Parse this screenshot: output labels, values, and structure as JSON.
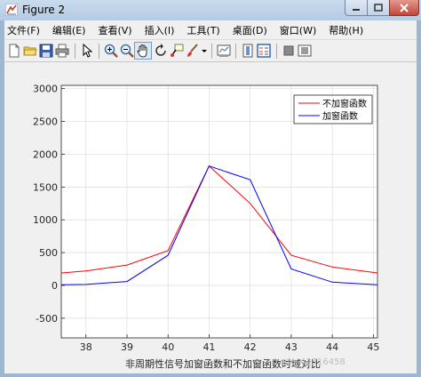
{
  "window": {
    "title": "Figure 2"
  },
  "menu": [
    "文件(F)",
    "编辑(E)",
    "查看(V)",
    "插入(I)",
    "工具(T)",
    "桌面(D)",
    "窗口(W)",
    "帮助(H)"
  ],
  "toolbar": {
    "icons": [
      "new-file-icon",
      "open-folder-icon",
      "save-icon",
      "print-icon",
      "pointer-icon",
      "zoom-in-icon",
      "zoom-out-icon",
      "pan-hand-icon",
      "rotate-3d-icon",
      "data-cursor-icon",
      "brush-icon",
      "brush-dropdown-icon",
      "link-plot-icon",
      "insert-colorbar-icon",
      "insert-legend-icon",
      "hide-plot-tools-icon",
      "show-plot-tools-icon"
    ]
  },
  "colors": {
    "series1": "#ff0000",
    "series2": "#0000ff"
  },
  "chart_data": {
    "type": "line",
    "xlabel": "非周期性信号加窗函数和不加窗函数时域对比",
    "ylabel": "",
    "xlim": [
      37.4,
      45.1
    ],
    "ylim": [
      -800,
      3050
    ],
    "xticks": [
      38,
      39,
      40,
      41,
      42,
      43,
      44,
      45
    ],
    "yticks": [
      -500,
      0,
      500,
      1000,
      1500,
      2000,
      2500,
      3000
    ],
    "grid": true,
    "legend_position": "top-right",
    "series": [
      {
        "name": "不加窗函数",
        "color": "#ff0000",
        "x": [
          37.4,
          38,
          39,
          40,
          41,
          42,
          43,
          44,
          45.1
        ],
        "y": [
          190,
          220,
          310,
          530,
          1820,
          1250,
          460,
          280,
          190
        ]
      },
      {
        "name": "加窗函数",
        "color": "#0000ff",
        "x": [
          37.4,
          38,
          39,
          40,
          41,
          42,
          43,
          44,
          45.1
        ],
        "y": [
          10,
          15,
          60,
          460,
          1820,
          1610,
          250,
          50,
          10
        ]
      }
    ]
  },
  "watermark": "sdn_42316458"
}
